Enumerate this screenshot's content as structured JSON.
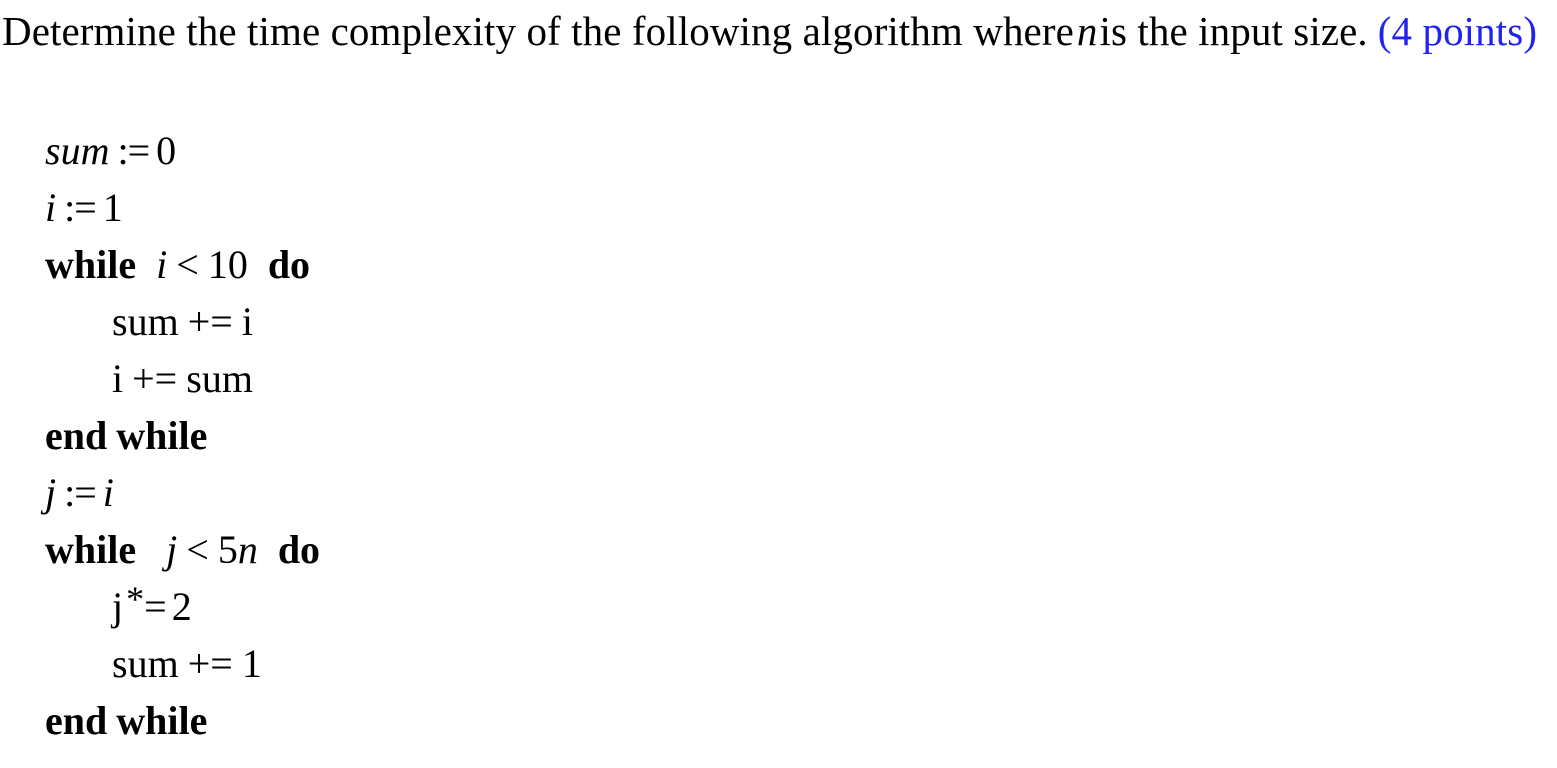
{
  "document": {
    "background_color": "#ffffff",
    "text_color": "#000000",
    "accent_color": "#2222ee"
  },
  "question": {
    "text_part_1": "Determine the time complexity of the following algorithm where",
    "variable": "n",
    "text_part_2": "is the input size.",
    "points_label": "(4 points)"
  },
  "algorithm": {
    "lines": [
      {
        "id": "line-sum-init",
        "indent": 0,
        "text": "sum := 0",
        "tokens": {
          "lhs": "sum",
          "assign": ":=",
          "rhs": "0"
        }
      },
      {
        "id": "line-i-init",
        "indent": 0,
        "text": "i := 1",
        "tokens": {
          "lhs": "i",
          "assign": ":=",
          "rhs": "1"
        }
      },
      {
        "id": "line-while-1",
        "indent": 0,
        "text": "while i < 10 do",
        "tokens": {
          "kw_start": "while",
          "var": "i",
          "rel": "<",
          "bound": "10",
          "kw_end": "do"
        }
      },
      {
        "id": "line-sum-plus-i",
        "indent": 1,
        "text": "sum += i",
        "tokens": {
          "lhs": "sum",
          "op": "+=",
          "rhs": "i"
        }
      },
      {
        "id": "line-i-plus-sum",
        "indent": 1,
        "text": "i += sum",
        "tokens": {
          "lhs": "i",
          "op": "+=",
          "rhs": "sum"
        }
      },
      {
        "id": "line-end-while-1",
        "indent": 0,
        "text": "end while",
        "tokens": {
          "kw_end_1": "end",
          "kw_end_2": "while"
        }
      },
      {
        "id": "line-j-init",
        "indent": 0,
        "text": "j := i",
        "tokens": {
          "lhs": "j",
          "assign": ":=",
          "rhs": "i"
        }
      },
      {
        "id": "line-while-2",
        "indent": 0,
        "text": "while  j < 5n do",
        "tokens": {
          "kw_start": "while",
          "var": "j",
          "rel": "<",
          "coeff": "5",
          "bound_var": "n",
          "kw_end": "do"
        }
      },
      {
        "id": "line-j-times-2",
        "indent": 1,
        "text": "j *= 2",
        "tokens": {
          "lhs": "j",
          "star": "*",
          "eq": "=",
          "rhs": "2"
        }
      },
      {
        "id": "line-sum-plus-1",
        "indent": 1,
        "text": "sum += 1",
        "tokens": {
          "lhs": "sum",
          "op": "+=",
          "rhs": "1"
        }
      },
      {
        "id": "line-end-while-2",
        "indent": 0,
        "text": "end while",
        "tokens": {
          "kw_end_1": "end",
          "kw_end_2": "while"
        }
      }
    ]
  }
}
